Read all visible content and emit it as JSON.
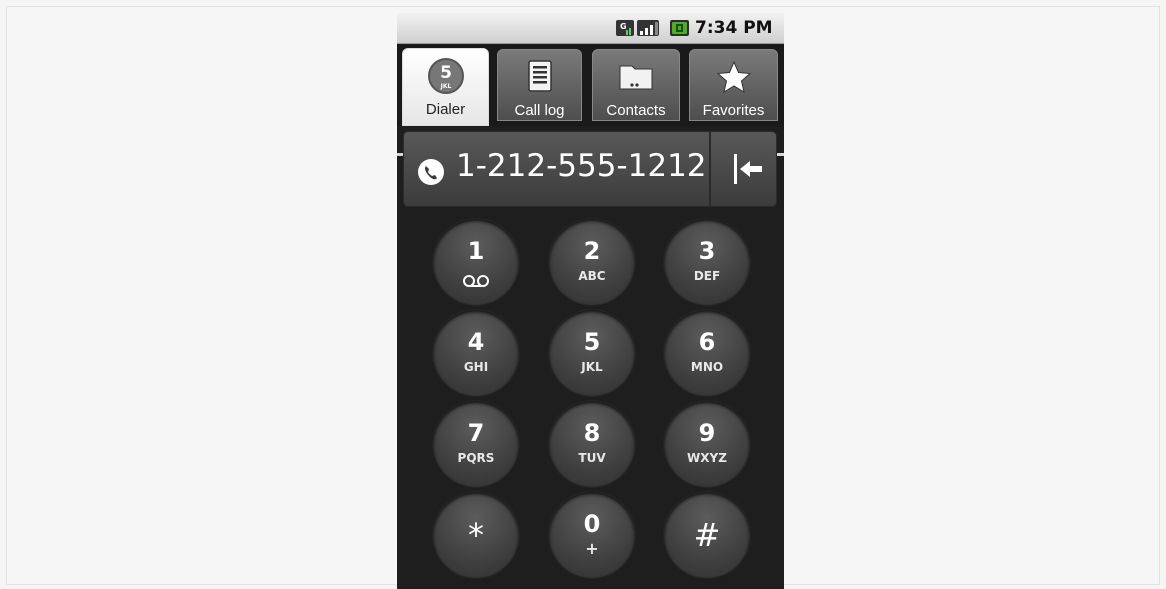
{
  "status_bar": {
    "time": "7:34 PM",
    "icons": [
      "data-network-icon",
      "signal-strength-icon",
      "battery-icon"
    ]
  },
  "tabs": [
    {
      "label": "Dialer",
      "icon": "dialpad-5-icon",
      "active": true
    },
    {
      "label": "Call log",
      "icon": "call-log-icon",
      "active": false
    },
    {
      "label": "Contacts",
      "icon": "contacts-folder-icon",
      "active": false
    },
    {
      "label": "Favorites",
      "icon": "star-icon",
      "active": false
    }
  ],
  "dialer": {
    "number": "1-212-555-1212",
    "backspace_icon": "backspace-arrow-icon"
  },
  "tab_icon_text": {
    "digit": "5",
    "letters": "JKL"
  },
  "keypad": [
    {
      "digit": "1",
      "letters": "",
      "extra": "voicemail-icon"
    },
    {
      "digit": "2",
      "letters": "ABC"
    },
    {
      "digit": "3",
      "letters": "DEF"
    },
    {
      "digit": "4",
      "letters": "GHI"
    },
    {
      "digit": "5",
      "letters": "JKL"
    },
    {
      "digit": "6",
      "letters": "MNO"
    },
    {
      "digit": "7",
      "letters": "PQRS"
    },
    {
      "digit": "8",
      "letters": "TUV"
    },
    {
      "digit": "9",
      "letters": "WXYZ"
    },
    {
      "digit": "*",
      "letters": ""
    },
    {
      "digit": "0",
      "letters": "+"
    },
    {
      "digit": "#",
      "letters": ""
    }
  ],
  "colors": {
    "background": "#1e1e1e",
    "status_bar": "#dcdcdc",
    "active_tab": "#ffffff",
    "inactive_tab": "#5e5e5e",
    "key": "#444444"
  }
}
